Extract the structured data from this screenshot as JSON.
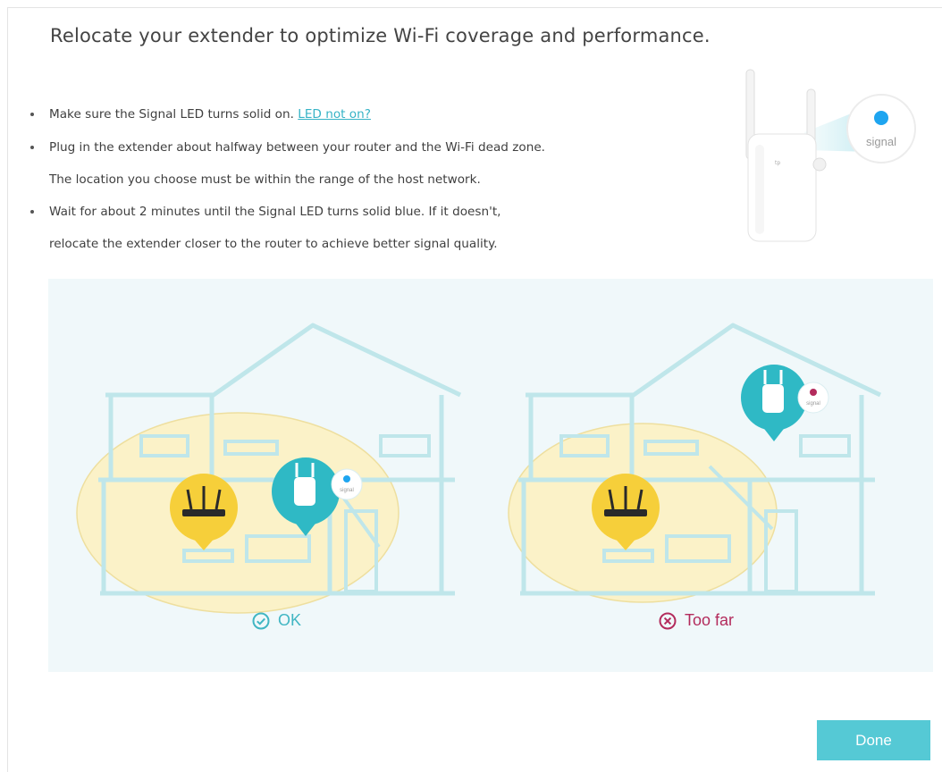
{
  "dialog": {
    "title": "Relocate your extender to optimize Wi-Fi coverage and performance.",
    "bullets": [
      {
        "text": "Make sure the Signal LED turns solid on. ",
        "link": "LED not on?"
      },
      {
        "text": "Plug in the extender about halfway between your router and the Wi-Fi dead zone.",
        "line2": "The location you choose must be within the range of the host network."
      },
      {
        "text": "Wait for about 2 minutes until the Signal LED turns solid blue. If it doesn't,",
        "line2": "relocate the extender closer to the router to achieve better signal quality."
      }
    ],
    "device_bubble_label": "signal",
    "scenarios": [
      {
        "status": "OK",
        "bubble_label": "signal",
        "icon": "check-circle-icon",
        "color": "#41b6c3"
      },
      {
        "status": "Too far",
        "bubble_label": "signal",
        "icon": "x-circle-icon",
        "color": "#b32b5c"
      }
    ],
    "done_label": "Done",
    "colors": {
      "accent": "#55c9d5",
      "link": "#36b3c6",
      "house_line": "#bfe6ea",
      "coverage": "#fbf2c8",
      "router": "#f6cf3a",
      "extender": "#2fb9c5",
      "bad": "#b32b5c",
      "signal_ok": "#1ea5f0"
    }
  }
}
